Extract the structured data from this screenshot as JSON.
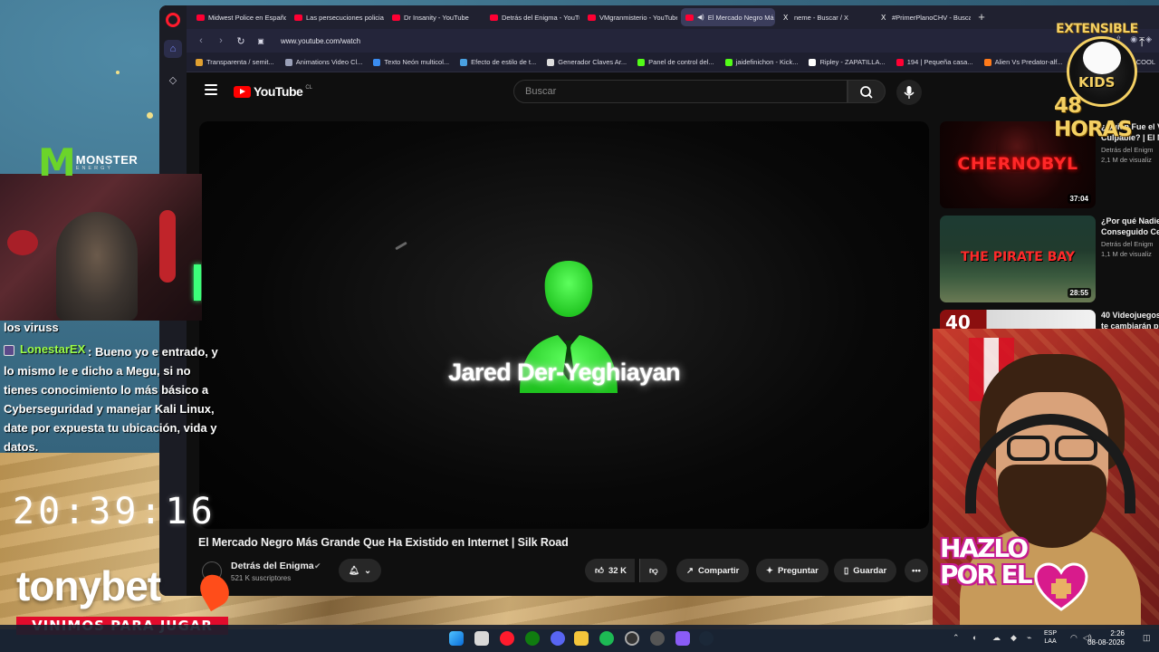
{
  "browser": {
    "tabs": [
      {
        "label": "Midwest Police en Españo",
        "icon": "youtube-icon"
      },
      {
        "label": "Las persecuciones policial",
        "icon": "youtube-icon"
      },
      {
        "label": "Dr Insanity - YouTube",
        "icon": "youtube-icon"
      },
      {
        "label": "Detrás del Enigma - YouTu",
        "icon": "youtube-icon"
      },
      {
        "label": "VMgranmisterio - YouTube",
        "icon": "youtube-icon"
      },
      {
        "label": "El Mercado Negro Má",
        "icon": "youtube-icon",
        "active": true
      },
      {
        "label": "neme - Buscar / X",
        "icon": "x-icon"
      },
      {
        "label": "#PrimerPlanoCHV - Busca",
        "icon": "x-icon"
      }
    ],
    "url": "www.youtube.com/watch",
    "bookmarks": [
      {
        "label": "Transparenta / semit...",
        "color": "#e0a030"
      },
      {
        "label": "Animations Video Cl...",
        "color": "#9aa0b8"
      },
      {
        "label": "Texto Neón multicol...",
        "color": "#3a8cf0"
      },
      {
        "label": "Efecto de estilo de t...",
        "color": "#4aa0e0"
      },
      {
        "label": "Generador Claves Ar...",
        "color": "#dddddd"
      },
      {
        "label": "Panel de control del...",
        "color": "#53fc18"
      },
      {
        "label": "jaidefinichon - Kick...",
        "color": "#53fc18"
      },
      {
        "label": "Ripley - ZAPATILLA...",
        "color": "#ffffff"
      },
      {
        "label": "194 | Pequeña casa...",
        "color": "#ff0033"
      },
      {
        "label": "Alien Vs Predator-alf...",
        "color": "#ff7a1a"
      },
      {
        "label": "cre",
        "color": "#ff0033"
      }
    ],
    "bookmarks_extra": "COOL"
  },
  "youtube": {
    "logo": "YouTube",
    "region": "CL",
    "search_placeholder": "Buscar",
    "video_overlay_name": "Jared Der-Yeghiayan",
    "video_title": "El Mercado Negro Más Grande Que Ha Existido en Internet | Silk Road",
    "channel_name": "Detrás del Enigma",
    "subscribers": "521 K suscriptores",
    "likes": "32 K",
    "share_label": "Compartir",
    "ask_label": "Preguntar",
    "save_label": "Guardar",
    "recommendations": [
      {
        "thumb_word": "CHERNOBYL",
        "duration": "37:04",
        "title_l1": "¿Quién Fue el V",
        "title_l2": "Culpable? | El M",
        "channel": "Detrás del Enigm",
        "views": "2,1 M de visualiz"
      },
      {
        "thumb_word": "THE PIRATE BAY",
        "duration": "28:55",
        "title_l1": "¿Por qué Nadie",
        "title_l2": "Conseguido Ce",
        "channel": "Detrás del Enigm",
        "views": "1,1 M de visualiz"
      },
      {
        "thumb_word": "40",
        "duration": "",
        "title_l1": "40 Videojuegos",
        "title_l2": "te cambiarán p",
        "channel": "",
        "views": ""
      }
    ]
  },
  "stream": {
    "chat_prev": "los viruss",
    "chat_user": "LonestarEX",
    "chat_message": ": Bueno yo e entrado, y lo mismo le e dicho a Megu, si no tienes conocimiento lo más básico a Cyberseguridad y manejar Kali Linux, date por expuesta tu ubicación, vida y datos.",
    "clock": "20:39:16",
    "sponsor_word": "tonybet",
    "sponsor_banner": "VINIMOS PARA JUGAR",
    "monster_word": "MONSTER",
    "monster_sub": "ENERGY",
    "kids_top": "EXTENSIBLE",
    "kids_word": "KIDS",
    "kids_hours": "48 HORAS",
    "hazlo": "HAZLO POR EL"
  },
  "taskbar": {
    "lang_l1": "ESP",
    "lang_l2": "LAA",
    "time": "2:26",
    "date": "08-08-2026"
  }
}
